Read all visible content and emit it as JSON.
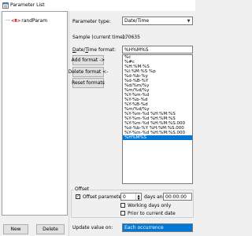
{
  "window": {
    "title": "Parameter List"
  },
  "tree": {
    "node_label": "randParam",
    "node_icon": "<R>"
  },
  "parameter_type": {
    "label": "Parameter type:",
    "value": "Date/Time"
  },
  "sample": {
    "label": "Sample (current time):",
    "value": "170635"
  },
  "format": {
    "label": "Date/Time format:",
    "value": "%H%M%S"
  },
  "buttons": {
    "add_format": "Add format ->",
    "delete_format": "Delete format <-",
    "reset_formats": "Reset formats",
    "new": "New",
    "delete": "Delete"
  },
  "format_list": {
    "items": [
      "%c",
      "%#c",
      "%H:%M:%S",
      "%I:%M:%S %p",
      "%d-%b-%y",
      "%d-%B-%Y",
      "%d/%m/%y",
      "%m/%d/%y",
      "%Y-%m-%d",
      "%Y-%b-%d",
      "%Y-%B-%d",
      "%m/%d/%y",
      "%Y-%m-%d %H:%M:%S",
      "%Y-%m-%d %H:%M:%S",
      "%Y-%m-%d %H:%M:%S.000",
      "%d-%b-%Y %H:%M:%S.000",
      "%Y-%m-%d %H:%M:%S.000",
      "%H%M%S"
    ],
    "selected_index": 17
  },
  "offset": {
    "group_title": "Offset",
    "offset_by_label": "Offset parameter by:",
    "offset_checked": true,
    "days_value": "0",
    "days_label": "days and",
    "time_value": "00:00:00",
    "working_days_label": "Working days only",
    "working_days_checked": false,
    "prior_label": "Prior to current date",
    "prior_checked": false
  },
  "update": {
    "label": "Update value on:",
    "value": "Each occurrence"
  },
  "colors": {
    "selection": "#0078d7",
    "window_bg": "#f0f0f0"
  }
}
